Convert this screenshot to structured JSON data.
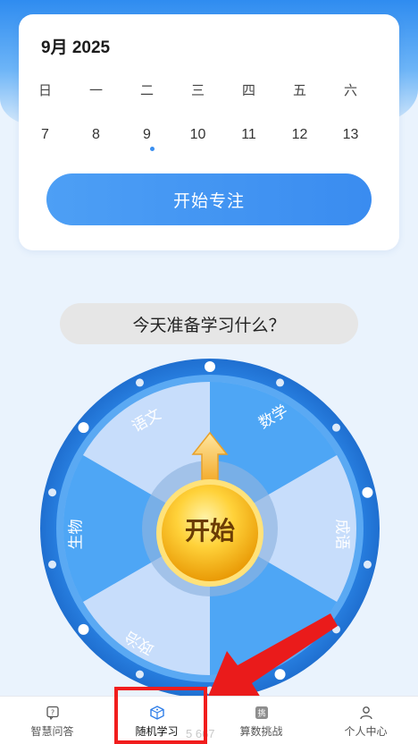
{
  "calendar": {
    "month_title": "9月 2025",
    "weekdays": [
      "日",
      "一",
      "二",
      "三",
      "四",
      "五",
      "六"
    ],
    "days": [
      "7",
      "8",
      "9",
      "10",
      "11",
      "12",
      "13"
    ],
    "selected_day": "9",
    "focus_button_label": "开始专注"
  },
  "wheel": {
    "question": "今天准备学习什么？",
    "start_label": "开始",
    "segments": [
      "数学",
      "成语",
      "政治",
      "生物",
      "语文"
    ]
  },
  "tabs": [
    {
      "label": "智慧问答",
      "icon": "qa-icon",
      "active": false
    },
    {
      "label": "随机学习",
      "icon": "dice-icon",
      "active": true
    },
    {
      "label": "算数挑战",
      "icon": "challenge-icon",
      "active": false
    },
    {
      "label": "个人中心",
      "icon": "user-icon",
      "active": false
    }
  ],
  "overlay": {
    "partial_number": "5 667",
    "highlight_color": "#f11d1d"
  },
  "colors": {
    "primary": "#3a8cf0",
    "wheel_dark_segment": "#4ea6f5",
    "wheel_light_segment": "#c7ddfb",
    "start_button": "#f6c21c"
  }
}
